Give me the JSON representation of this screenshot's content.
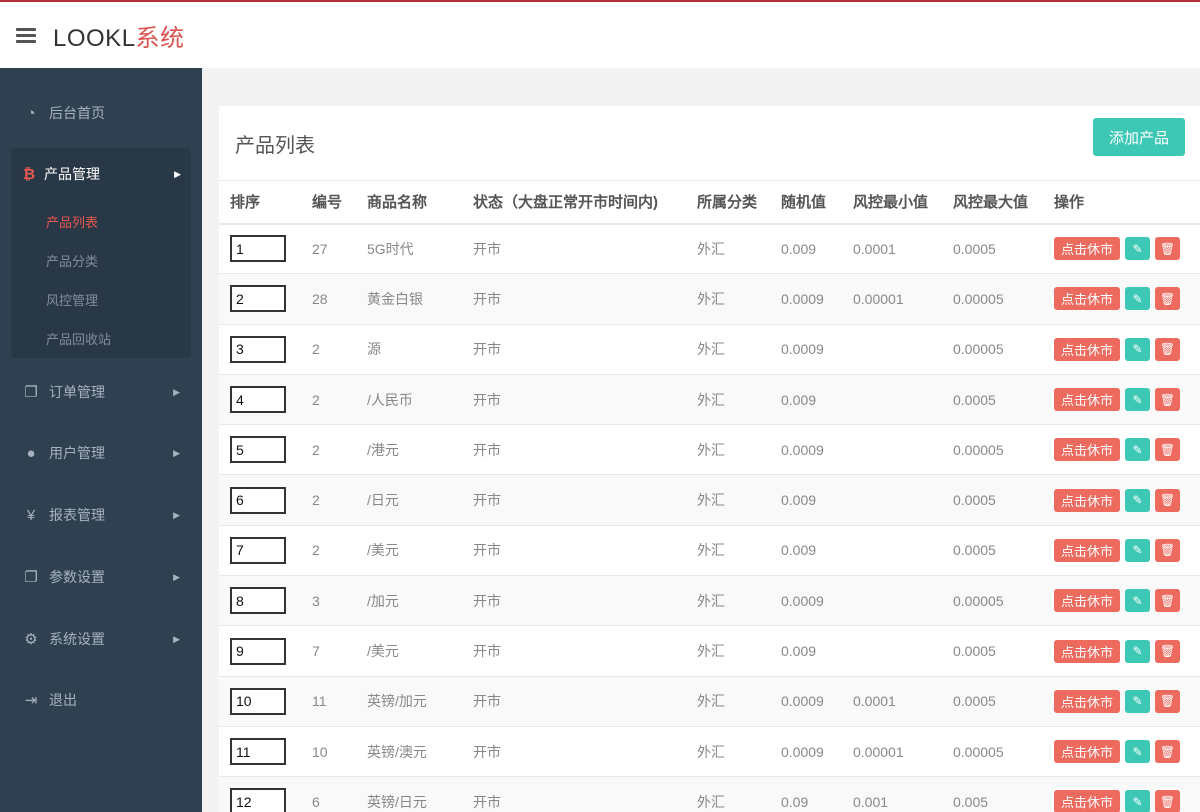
{
  "app": {
    "title_main": "LOOKL",
    "title_accent": "系统"
  },
  "sidebar": {
    "items": [
      {
        "label": "后台首页",
        "icon": "dashboard-icon"
      },
      {
        "label": "订单管理",
        "icon": "copy-icon"
      },
      {
        "label": "用户管理",
        "icon": "user-icon"
      },
      {
        "label": "报表管理",
        "icon": "yen-icon"
      },
      {
        "label": "参数设置",
        "icon": "copy-icon"
      },
      {
        "label": "系统设置",
        "icon": "gears-icon"
      },
      {
        "label": "退出",
        "icon": "sign-out-icon"
      }
    ],
    "group": {
      "label": "产品管理",
      "icon": "bitcoin-icon",
      "subitems": [
        "产品列表",
        "产品分类",
        "风控管理",
        "产品回收站"
      ]
    }
  },
  "page": {
    "title": "产品列表",
    "add_button": "添加产品"
  },
  "table": {
    "headers": [
      "排序",
      "编号",
      "商品名称",
      "状态（大盘正常开市时间内)",
      "所属分类",
      "随机值",
      "风控最小值",
      "风控最大值",
      "操作"
    ],
    "rows": [
      {
        "sort": "1",
        "id": "27",
        "name": "5G时代",
        "status": "开市",
        "category": "外汇",
        "random": "0.009",
        "min": "0.0001",
        "max": "0.0005"
      },
      {
        "sort": "2",
        "id": "28",
        "name": "黄金白银",
        "status": "开市",
        "category": "外汇",
        "random": "0.0009",
        "min": "0.00001",
        "max": "0.00005"
      },
      {
        "sort": "3",
        "id": "2",
        "name": "源",
        "status": "开市",
        "category": "外汇",
        "random": "0.0009",
        "min": "",
        "max": "0.00005"
      },
      {
        "sort": "4",
        "id": "2",
        "name": "/人民币",
        "status": "开市",
        "category": "外汇",
        "random": "0.009",
        "min": "",
        "max": "0.0005"
      },
      {
        "sort": "5",
        "id": "2",
        "name": "/港元",
        "status": "开市",
        "category": "外汇",
        "random": "0.0009",
        "min": "",
        "max": "0.00005"
      },
      {
        "sort": "6",
        "id": "2",
        "name": "/日元",
        "status": "开市",
        "category": "外汇",
        "random": "0.009",
        "min": "",
        "max": "0.0005"
      },
      {
        "sort": "7",
        "id": "2",
        "name": "/美元",
        "status": "开市",
        "category": "外汇",
        "random": "0.009",
        "min": "",
        "max": "0.0005"
      },
      {
        "sort": "8",
        "id": "3",
        "name": "/加元",
        "status": "开市",
        "category": "外汇",
        "random": "0.0009",
        "min": "",
        "max": "0.00005"
      },
      {
        "sort": "9",
        "id": "7",
        "name": "/美元",
        "status": "开市",
        "category": "外汇",
        "random": "0.009",
        "min": "",
        "max": "0.0005"
      },
      {
        "sort": "10",
        "id": "11",
        "name": "英镑/加元",
        "status": "开市",
        "category": "外汇",
        "random": "0.0009",
        "min": "0.0001",
        "max": "0.0005"
      },
      {
        "sort": "11",
        "id": "10",
        "name": "英镑/澳元",
        "status": "开市",
        "category": "外汇",
        "random": "0.0009",
        "min": "0.00001",
        "max": "0.00005"
      },
      {
        "sort": "12",
        "id": "6",
        "name": "英镑/日元",
        "status": "开市",
        "category": "外汇",
        "random": "0.09",
        "min": "0.001",
        "max": "0.005"
      }
    ],
    "action_label": "点击休市"
  },
  "colors": {
    "sidebar": "#2f4050",
    "accent_red": "#ed6a5f",
    "accent_teal": "#3dc8b5"
  }
}
